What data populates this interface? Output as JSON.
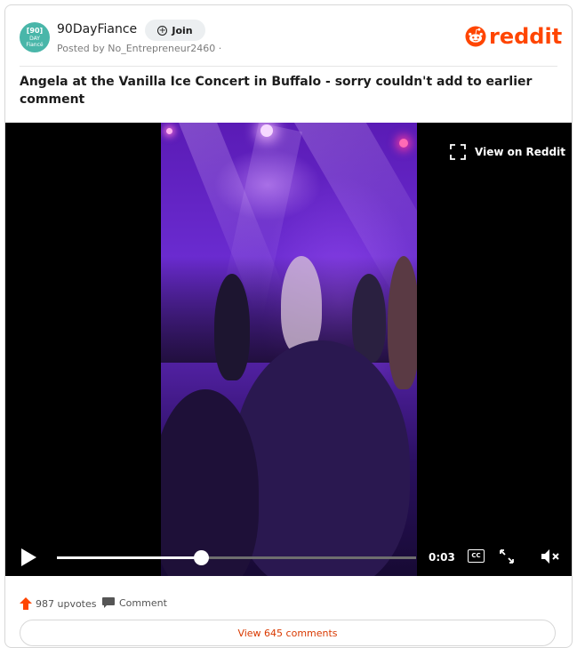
{
  "header": {
    "avatar_lines": [
      "[90]",
      "DAY",
      "Fiancé"
    ],
    "subreddit": "90DayFiance",
    "join_label": "Join",
    "posted_by": "Posted by No_Entrepreneur2460 ·",
    "brand": "reddit"
  },
  "post": {
    "title": "Angela at the Vanilla Ice Concert in Buffalo - sorry couldn't add to earlier comment"
  },
  "video": {
    "view_on_reddit": "View on Reddit",
    "time": "0:03",
    "cc_label": "CC",
    "progress_fraction": 0.4
  },
  "footer": {
    "upvotes": "987 upvotes",
    "comment_label": "Comment",
    "view_comments": "View 645 comments"
  },
  "colors": {
    "brand": "#ff4500",
    "avatar": "#49b6a9",
    "link": "#d93900"
  }
}
